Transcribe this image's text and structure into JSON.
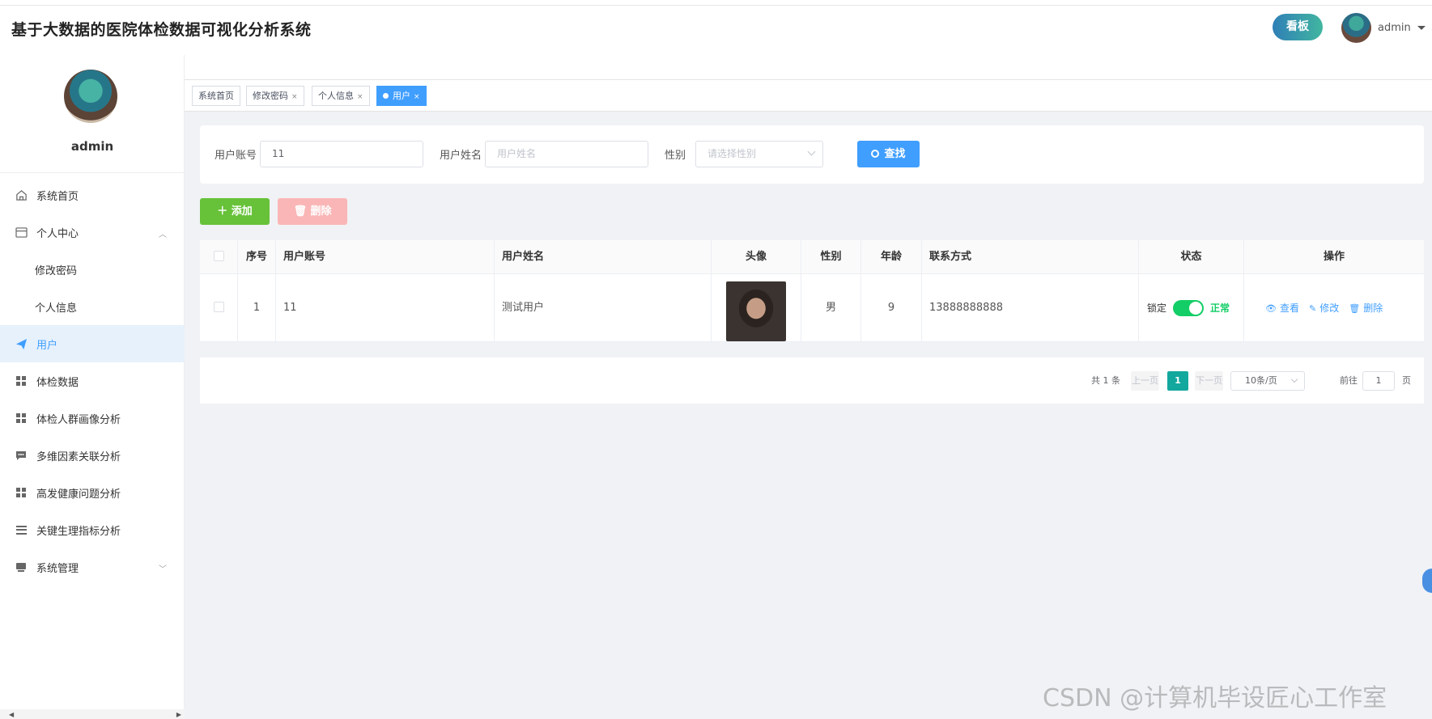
{
  "header": {
    "title": "基于大数据的医院体检数据可视化分析系统",
    "board_label": "看板",
    "user_name": "admin"
  },
  "sidebar": {
    "user_name": "admin",
    "items": [
      {
        "label": "系统首页",
        "icon": "home-icon"
      },
      {
        "label": "个人中心",
        "icon": "card-icon",
        "expanded": true
      },
      {
        "label": "修改密码",
        "sub": true
      },
      {
        "label": "个人信息",
        "sub": true
      },
      {
        "label": "用户",
        "icon": "paper-plane-icon",
        "active": true
      },
      {
        "label": "体检数据",
        "icon": "grid-icon"
      },
      {
        "label": "体检人群画像分析",
        "icon": "grid-icon"
      },
      {
        "label": "多维因素关联分析",
        "icon": "chat-icon"
      },
      {
        "label": "高发健康问题分析",
        "icon": "grid-icon"
      },
      {
        "label": "关键生理指标分析",
        "icon": "menu-lines-icon"
      },
      {
        "label": "系统管理",
        "icon": "monitor-icon",
        "expanded": false
      }
    ]
  },
  "tags": [
    {
      "label": "系统首页",
      "closable": false
    },
    {
      "label": "修改密码",
      "closable": true
    },
    {
      "label": "个人信息",
      "closable": true
    },
    {
      "label": "用户",
      "closable": true,
      "active": true
    }
  ],
  "search": {
    "account_label": "用户账号",
    "account_value": "11",
    "name_label": "用户姓名",
    "name_placeholder": "用户姓名",
    "gender_label": "性别",
    "gender_placeholder": "请选择性别",
    "find_label": "查找"
  },
  "actions": {
    "add_label": "添加",
    "delete_label": "删除"
  },
  "table": {
    "headers": [
      "序号",
      "用户账号",
      "用户姓名",
      "头像",
      "性别",
      "年龄",
      "联系方式",
      "状态",
      "操作"
    ],
    "rows": [
      {
        "index": "1",
        "account": "11",
        "name": "测试用户",
        "gender": "男",
        "age": "9",
        "phone": "13888888888",
        "lock_label": "锁定",
        "status_on": true,
        "status_label": "正常",
        "ops": {
          "view": "查看",
          "edit": "修改",
          "delete": "删除"
        }
      }
    ]
  },
  "pagination": {
    "total": "共 1 条",
    "prev": "上一页",
    "current": "1",
    "next": "下一页",
    "page_size": "10条/页",
    "goto_label": "前往",
    "goto_value": "1",
    "page_suffix": "页"
  },
  "watermark": "CSDN @计算机毕设匠心工作室",
  "colors": {
    "primary": "#409eff",
    "success": "#67c23a",
    "danger_light": "#fab6b6",
    "switch_on": "#13ce66",
    "page_active": "#13a89e"
  }
}
